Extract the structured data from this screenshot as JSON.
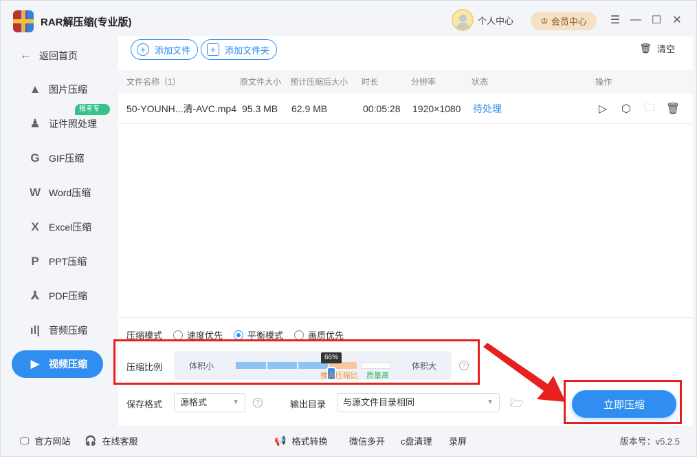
{
  "app": {
    "title": "RAR解压缩(专业版)"
  },
  "header": {
    "user_center": "个人中心",
    "member_center": "会员中心"
  },
  "sidebar": {
    "back": "返回首页",
    "items": [
      {
        "label": "图片压缩"
      },
      {
        "label": "证件照处理",
        "badge": "报考专用"
      },
      {
        "label": "GIF压缩"
      },
      {
        "label": "Word压缩"
      },
      {
        "label": "Excel压缩"
      },
      {
        "label": "PPT压缩"
      },
      {
        "label": "PDF压缩"
      },
      {
        "label": "音频压缩"
      },
      {
        "label": "视频压缩",
        "active": true
      }
    ]
  },
  "toolbar": {
    "add_file": "添加文件",
    "add_folder": "添加文件夹",
    "clear": "清空"
  },
  "table": {
    "headers": [
      "文件名称（1）",
      "原文件大小",
      "预计压缩后大小",
      "时长",
      "分辨率",
      "状态",
      "操作"
    ],
    "rows": [
      {
        "name": "50-YOUNH...清-AVC.mp4",
        "orig_size": "95.3 MB",
        "est_size": "62.9 MB",
        "duration": "00:05:28",
        "resolution": "1920×1080",
        "status": "待处理"
      }
    ]
  },
  "settings": {
    "mode_label": "压缩模式",
    "modes": [
      "速度优先",
      "平衡模式",
      "画质优先"
    ],
    "selected_mode": "平衡模式",
    "ratio_label": "压缩比例",
    "ratio_small": "体积小",
    "ratio_large": "体积大",
    "ratio_value": "66%",
    "ratio_fraction": 0.66,
    "recommended": "推荐压缩比",
    "high_quality": "质量高",
    "save_format_label": "保存格式",
    "save_format_value": "源格式",
    "output_dir_label": "输出目录",
    "output_dir_value": "与源文件目录相同"
  },
  "start_button": "立即压缩",
  "footer": {
    "website": "官方网站",
    "support": "在线客服",
    "format_convert": "格式转换",
    "wechat_multi": "微信多开",
    "c_clean": "c盘清理",
    "record": "录屏",
    "version": "版本号：v5.2.5"
  },
  "colors": {
    "accent": "#2f8ef0",
    "highlight": "#e6201f",
    "member": "#f4e1c6"
  }
}
